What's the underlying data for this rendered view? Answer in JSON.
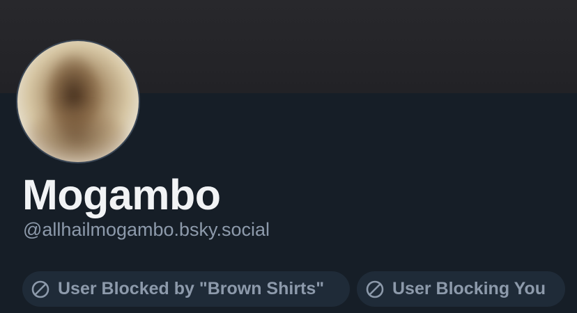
{
  "profile": {
    "display_name": "Mogambo",
    "handle": "@allhailmogambo.bsky.social"
  },
  "labels": [
    {
      "text": "User Blocked by \"Brown Shirts\"",
      "icon": "block-icon"
    },
    {
      "text": "User Blocking You",
      "icon": "block-icon"
    }
  ],
  "colors": {
    "background": "#161e27",
    "banner": "#242428",
    "pill_background": "#1f2b38",
    "muted_text": "#8d9aab",
    "name_text": "#f1f3f5"
  }
}
